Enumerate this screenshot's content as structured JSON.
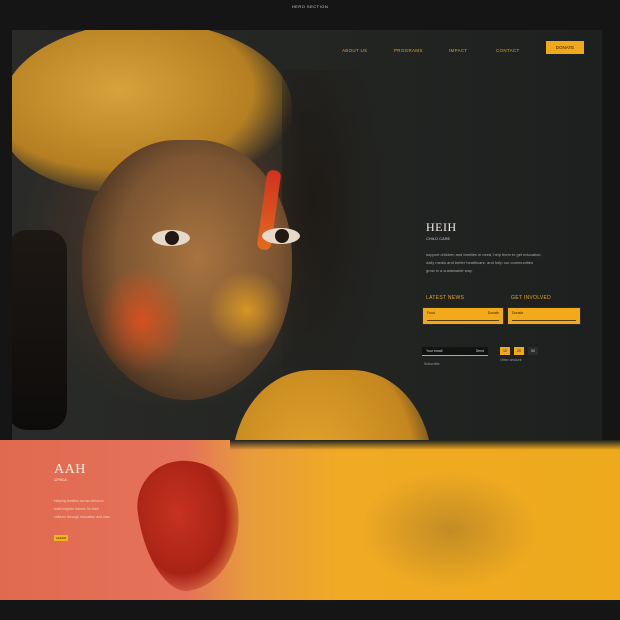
{
  "caption": "HERO SECTION",
  "nav": {
    "items": [
      "ABOUT US",
      "PROGRAMS",
      "IMPACT",
      "CONTACT"
    ],
    "cta": "DONATE"
  },
  "panel": {
    "title": "HEIH",
    "subtitle": "CHILD CARE",
    "body_lines": [
      "support children and families in need, help them to get education,",
      "daily meals and better healthcare, and help our communities",
      "grow in a sustainable way."
    ],
    "left_label": "LATEST NEWS",
    "right_label": "GET INVOLVED",
    "left_box": {
      "left": "Fund",
      "right": "Donate"
    },
    "right_box": {
      "left": "Donate",
      "right": ""
    },
    "input_left": "Your email",
    "input_right": "Send",
    "input_note": "Subscribe",
    "chips": [
      "10",
      "25",
      "50"
    ],
    "chip_note": "Other amount"
  },
  "band": {
    "title": "AAH",
    "subtitle": "AFRICA",
    "body_lines": [
      "Helping families across Africa to",
      "build brighter futures for their",
      "children through education and care."
    ],
    "button": "LEARN"
  },
  "colors": {
    "accent": "#f0a81d",
    "background": "#202220",
    "band_coral": "#e06a4f"
  }
}
